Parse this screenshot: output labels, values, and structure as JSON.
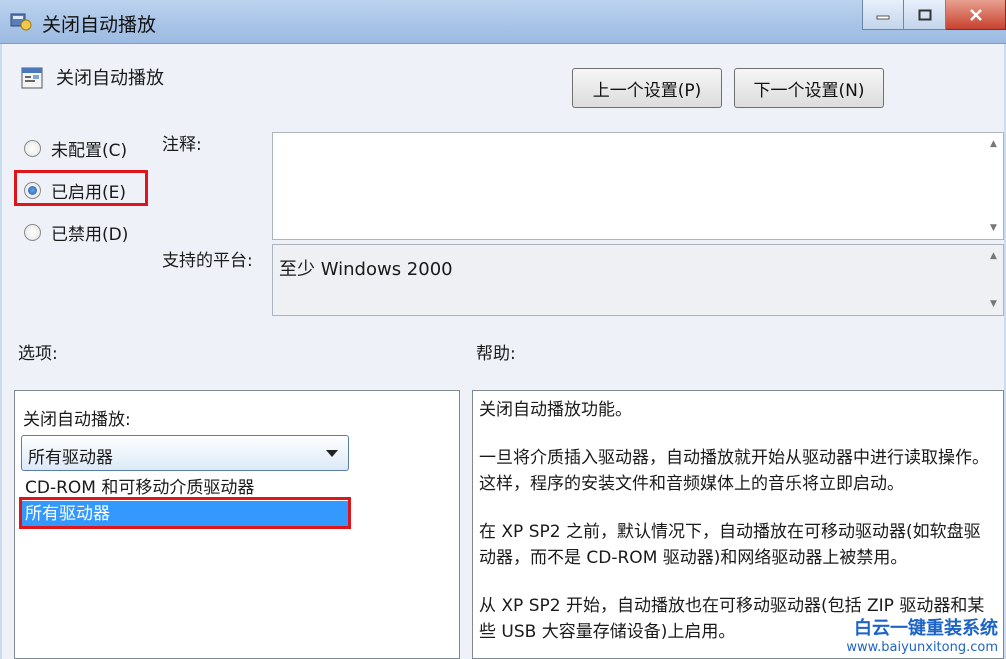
{
  "window": {
    "title": "关闭自动播放"
  },
  "header": {
    "setting_title": "关闭自动播放",
    "prev_button": "上一个设置(P)",
    "next_button": "下一个设置(N)"
  },
  "state": {
    "options": [
      {
        "label": "未配置(C)",
        "checked": false
      },
      {
        "label": "已启用(E)",
        "checked": true
      },
      {
        "label": "已禁用(D)",
        "checked": false
      }
    ]
  },
  "comment": {
    "label": "注释:",
    "value": ""
  },
  "platform": {
    "label": "支持的平台:",
    "value": "至少 Windows 2000"
  },
  "options_section": {
    "label": "选项:",
    "dropdown_label": "关闭自动播放:",
    "selected": "所有驱动器",
    "list": [
      "CD-ROM 和可移动介质驱动器",
      "所有驱动器"
    ]
  },
  "help_section": {
    "label": "帮助:",
    "paragraphs": [
      "关闭自动播放功能。",
      "一旦将介质插入驱动器，自动播放就开始从驱动器中进行读取操作。这样，程序的安装文件和音频媒体上的音乐将立即启动。",
      "在 XP SP2 之前，默认情况下，自动播放在可移动驱动器(如软盘驱动器，而不是 CD-ROM 驱动器)和网络驱动器上被禁用。",
      "从 XP SP2 开始，自动播放也在可移动驱动器(包括 ZIP 驱动器和某些 USB 大容量存储设备)上启用。"
    ]
  },
  "watermark": {
    "main": "白云一键重装系统",
    "url": "www.baiyunxitong.com"
  },
  "colors": {
    "highlight": "#e0141b",
    "selection": "#3399ff"
  }
}
